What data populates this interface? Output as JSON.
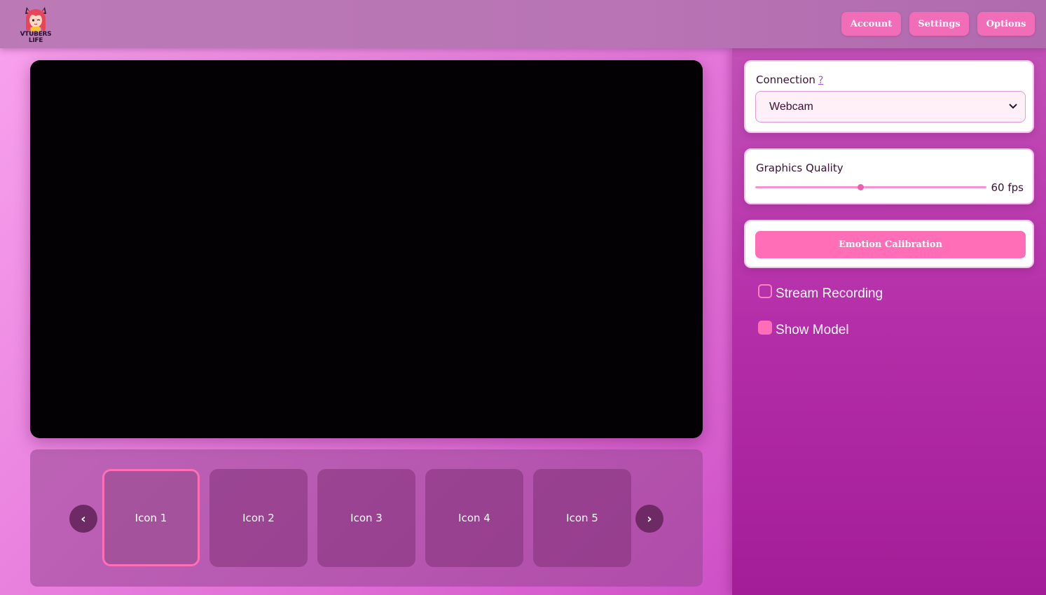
{
  "header": {
    "logo": {
      "line1": "VTUBERS",
      "line2": "LIFE"
    },
    "nav": [
      {
        "label": "Account"
      },
      {
        "label": "Settings"
      },
      {
        "label": "Options"
      }
    ]
  },
  "carousel": {
    "prev_label": "‹",
    "next_label": "›",
    "items": [
      {
        "label": "Icon 1",
        "selected": true
      },
      {
        "label": "Icon 2",
        "selected": false
      },
      {
        "label": "Icon 3",
        "selected": false
      },
      {
        "label": "Icon 4",
        "selected": false
      },
      {
        "label": "Icon 5",
        "selected": false
      }
    ]
  },
  "sidebar": {
    "connection": {
      "label": "Connection",
      "help": "?",
      "selected": "Webcam"
    },
    "graphics": {
      "label": "Graphics Quality",
      "value_label": "60 fps",
      "slider_fraction": 0.455
    },
    "calibration_label": "Emotion Calibration",
    "checkboxes": [
      {
        "label": "Stream Recording",
        "checked": false
      },
      {
        "label": "Show Model",
        "checked": true
      }
    ]
  },
  "colors": {
    "accent": "#ff6eb6",
    "header": "#b874b5",
    "sidebar": "#b52ea9",
    "video": "#030104"
  }
}
